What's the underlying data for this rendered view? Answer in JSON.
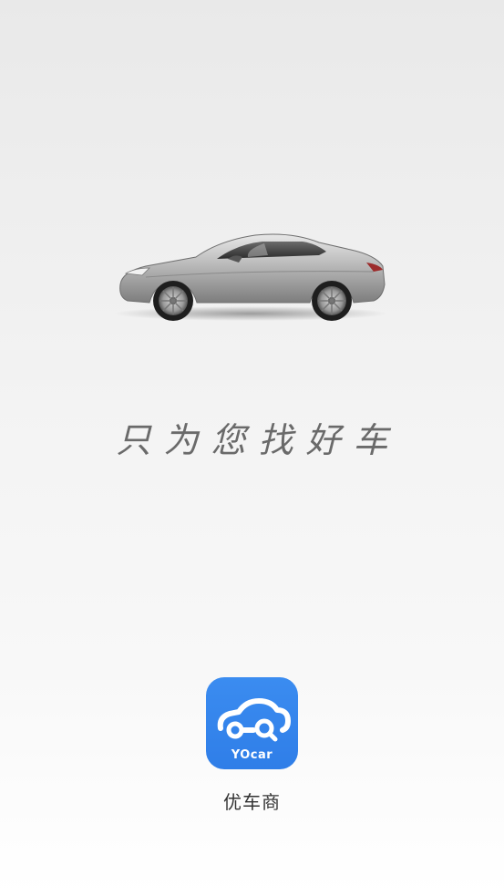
{
  "splash": {
    "slogan": "只为您找好车",
    "app_icon": {
      "brand_text": "YOcar",
      "icon": "car-search-icon",
      "background_color": "#2f7ee8"
    },
    "app_name": "优车商",
    "hero_image": "silver-sports-car-icon"
  }
}
